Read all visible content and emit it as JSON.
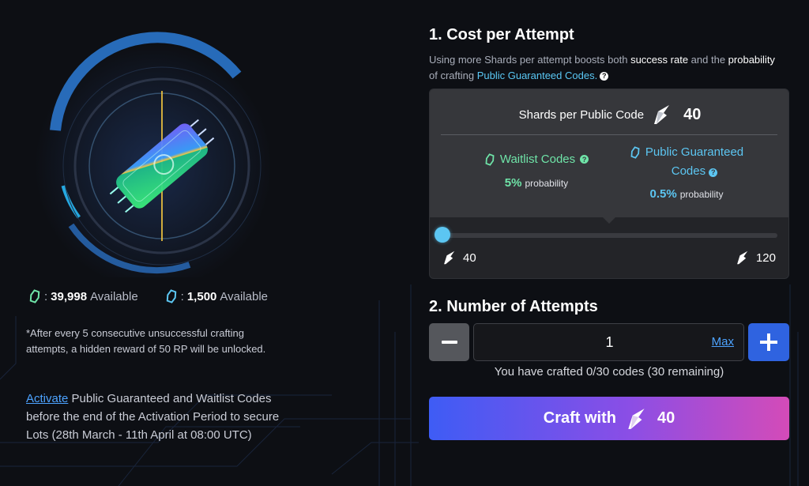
{
  "left": {
    "available": [
      {
        "icon": "waitlist-chip-icon",
        "value": "39,998",
        "suffix": "Available",
        "color": "#6fe4a8"
      },
      {
        "icon": "public-chip-icon",
        "value": "1,500",
        "suffix": "Available",
        "color": "#5cc6f2"
      }
    ],
    "note": "*After every 5 consecutive unsuccessful crafting attempts, a hidden reward of 50 RP will be unlocked.",
    "activate_link": "Activate",
    "activate_text": " Public Guaranteed and Waitlist Codes before the end of the Activation Period to secure Lots (28th March - 11th April at 08:00 UTC)"
  },
  "cost": {
    "title": "1. Cost per Attempt",
    "desc_1": "Using more Shards per attempt boosts both ",
    "desc_hl_1": "success rate",
    "desc_2": " and the ",
    "desc_hl_2": "probability",
    "desc_3": " of crafting ",
    "desc_link": "Public Guaranteed Codes.",
    "help": "?",
    "shards_label": "Shards per Public Code",
    "shards_value": "40",
    "option_1": {
      "label": "Waitlist Codes",
      "prob_value": "5%",
      "prob_label": "probability",
      "help": "?"
    },
    "option_2": {
      "label_line_1": "Public Guaranteed",
      "label_line_2": "Codes",
      "prob_value": "0.5%",
      "prob_label": "probability",
      "help": "?"
    },
    "slider_min": "40",
    "slider_max": "120",
    "slider_level": 0
  },
  "attempts": {
    "title": "2. Number of Attempts",
    "quantity": "1",
    "max_label": "Max",
    "crafted_text": "You have crafted 0/30 codes (30 remaining)"
  },
  "craft": {
    "label": "Craft with",
    "value": "40"
  },
  "colors": {
    "waitlist": "#6fe4a8",
    "public": "#5cc6f2",
    "accent_blue": "#2f63e0",
    "link": "#4da3ff"
  }
}
